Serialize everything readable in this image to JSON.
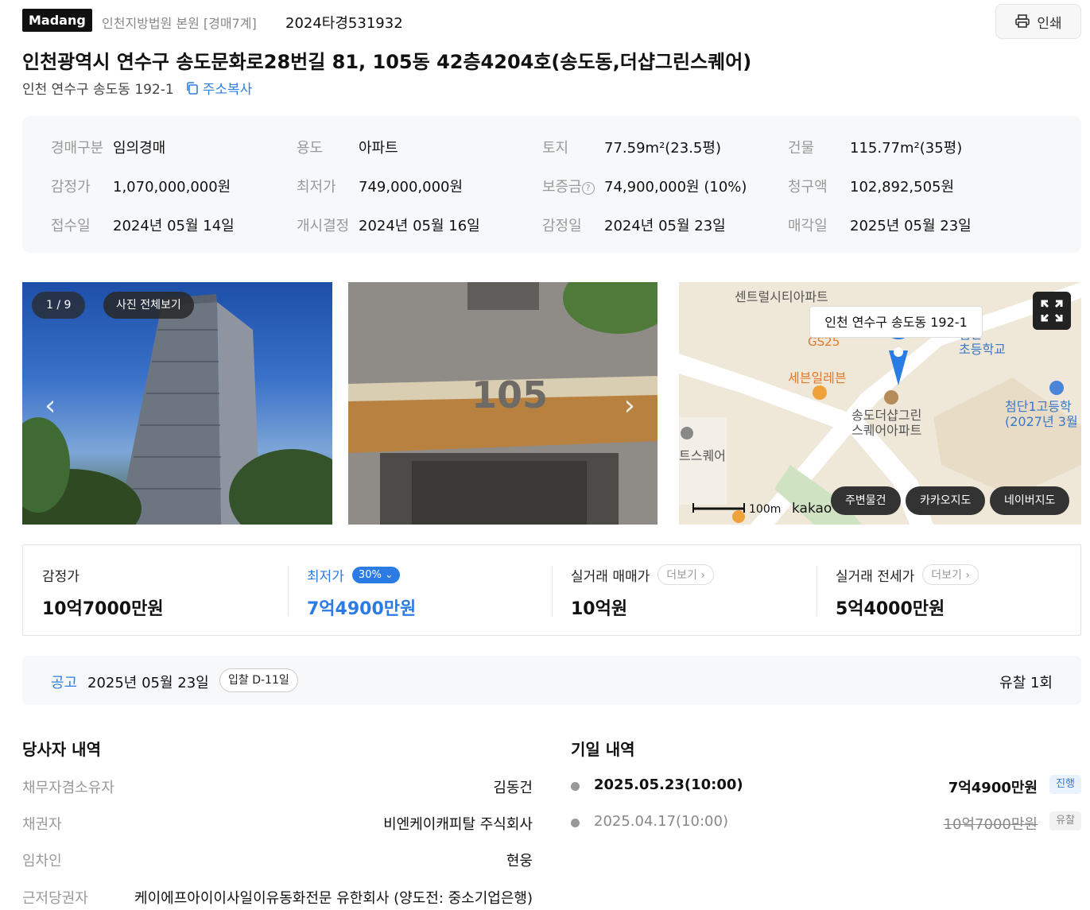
{
  "header": {
    "brand": "Madang",
    "court": "인천지방법원 본원 [경매7계]",
    "case_number": "2024타경531932",
    "print_label": "인쇄"
  },
  "address": {
    "title": "인천광역시 연수구 송도문화로28번길 81, 105동 42층4204호(송도동,더샵그린스퀘어)",
    "sub": "인천 연수구 송도동 192-1",
    "copy_label": "주소복사"
  },
  "info": [
    {
      "label": "경매구분",
      "value": "임의경매"
    },
    {
      "label": "용도",
      "value": "아파트"
    },
    {
      "label": "토지",
      "value": "77.59m²(23.5평)"
    },
    {
      "label": "건물",
      "value": "115.77m²(35평)"
    },
    {
      "label": "감정가",
      "value": "1,070,000,000원"
    },
    {
      "label": "최저가",
      "value": "749,000,000원"
    },
    {
      "label": "보증금",
      "value": "74,900,000원 (10%)"
    },
    {
      "label": "청구액",
      "value": "102,892,505원"
    },
    {
      "label": "접수일",
      "value": "2024년 05월 14일"
    },
    {
      "label": "개시결정",
      "value": "2024년 05월 16일"
    },
    {
      "label": "감정일",
      "value": "2024년 05월 23일"
    },
    {
      "label": "매각일",
      "value": "2025년 05월 23일"
    }
  ],
  "gallery": {
    "counter": "1 / 9",
    "view_all": "사진 전체보기",
    "building_sign": "105"
  },
  "map": {
    "callout": "인천 연수구 송도동 192-1",
    "labels": {
      "central": "센트럴시티아파트",
      "gs25": "GS25",
      "seven": "세븐일레븐",
      "complex": "송도더샵그린\n스퀘어아파트",
      "school_a": "첨단\n초등학교",
      "school_b": "첨단1고등학\n(2027년 3월",
      "square": "트스퀘어",
      "scale": "100m",
      "kakao": "kakao"
    },
    "buttons": [
      "주변물건",
      "카카오지도",
      "네이버지도"
    ]
  },
  "prices": [
    {
      "label": "감정가",
      "value": "10억7000만원"
    },
    {
      "label": "최저가",
      "badge": "30%",
      "value": "7억4900만원"
    },
    {
      "label": "실거래 매매가",
      "more": "더보기",
      "value": "10억원"
    },
    {
      "label": "실거래 전세가",
      "more": "더보기",
      "value": "5억4000만원"
    }
  ],
  "notice": {
    "label": "공고",
    "date": "2025년 05월 23일",
    "dday": "입찰 D-11일",
    "fail_count": "유찰 1회"
  },
  "parties": {
    "title": "당사자 내역",
    "rows": [
      {
        "label": "채무자겸소유자",
        "value": "김동건"
      },
      {
        "label": "채권자",
        "value": "비엔케이캐피탈 주식회사"
      },
      {
        "label": "임차인",
        "value": "현웅"
      },
      {
        "label": "근저당권자",
        "value": "케이에프아이이사일이유동화전문 유한회사 (양도전: 중소기업은행)"
      }
    ]
  },
  "schedule": {
    "title": "기일 내역",
    "rows": [
      {
        "date": "2025.05.23(10:00)",
        "price": "7억4900만원",
        "status": "진행"
      },
      {
        "date": "2025.04.17(10:00)",
        "price": "10억7000만원",
        "status": "유찰"
      }
    ]
  },
  "colors": {
    "accent": "#2b7be4",
    "brand_bg": "#111111",
    "info_bg": "#f7f8f9"
  }
}
